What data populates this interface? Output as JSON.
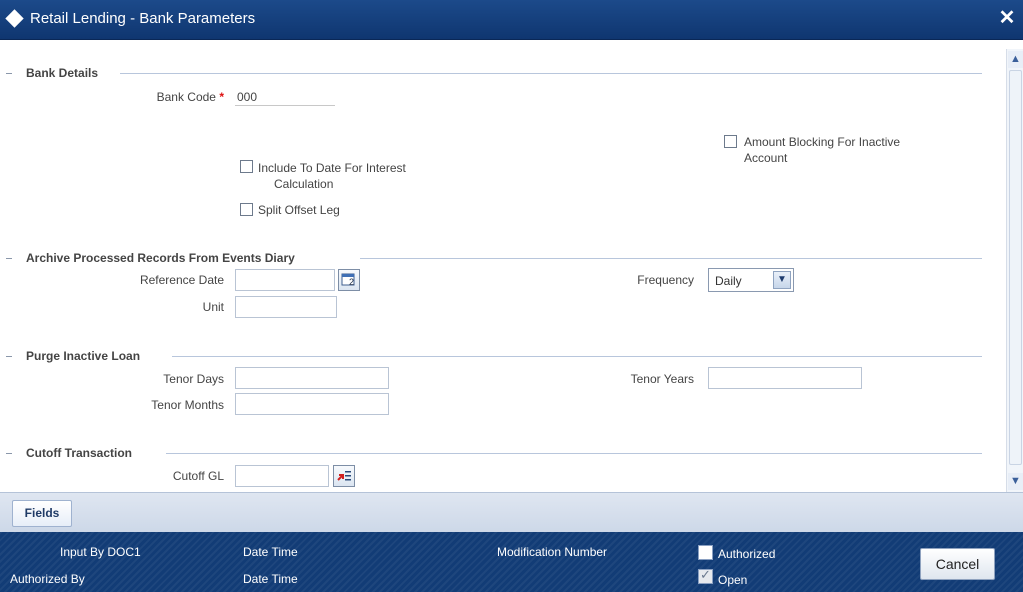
{
  "window": {
    "title": "Retail Lending - Bank Parameters",
    "close_glyph": "✕"
  },
  "bank_details": {
    "title": "Bank Details",
    "bank_code_label": "Bank Code",
    "required_mark": "*",
    "bank_code_value": "000",
    "amount_blocking_label_line1": "Amount Blocking For Inactive",
    "amount_blocking_label_line2": "Account",
    "amount_blocking_checked": false,
    "include_to_date_label_line1": "Include To Date For Interest",
    "include_to_date_label_line2": "Calculation",
    "include_to_date_checked": false,
    "split_offset_label": "Split Offset Leg",
    "split_offset_checked": false
  },
  "archive": {
    "title": "Archive Processed Records From Events Diary",
    "reference_date_label": "Reference Date",
    "reference_date_value": "",
    "unit_label": "Unit",
    "unit_value": "",
    "frequency_label": "Frequency",
    "frequency_value": "Daily",
    "calendar_icon": "calendar-icon"
  },
  "purge": {
    "title": "Purge Inactive Loan",
    "tenor_days_label": "Tenor Days",
    "tenor_days_value": "",
    "tenor_months_label": "Tenor Months",
    "tenor_months_value": "",
    "tenor_years_label": "Tenor Years",
    "tenor_years_value": ""
  },
  "cutoff": {
    "title": "Cutoff Transaction",
    "cutoff_gl_label": "Cutoff GL",
    "cutoff_gl_value": "",
    "lov_icon": "list-of-values-icon"
  },
  "tabs": [
    {
      "label": "Fields"
    }
  ],
  "footer": {
    "input_by_label": "Input By DOC1",
    "date_time_label_1": "Date Time",
    "modification_number_label": "Modification Number",
    "authorized_checkbox_label": "Authorized",
    "authorized_checked": false,
    "authorized_by_label": "Authorized By",
    "date_time_label_2": "Date Time",
    "open_checkbox_label": "Open",
    "open_checked": true,
    "cancel_label": "Cancel"
  }
}
